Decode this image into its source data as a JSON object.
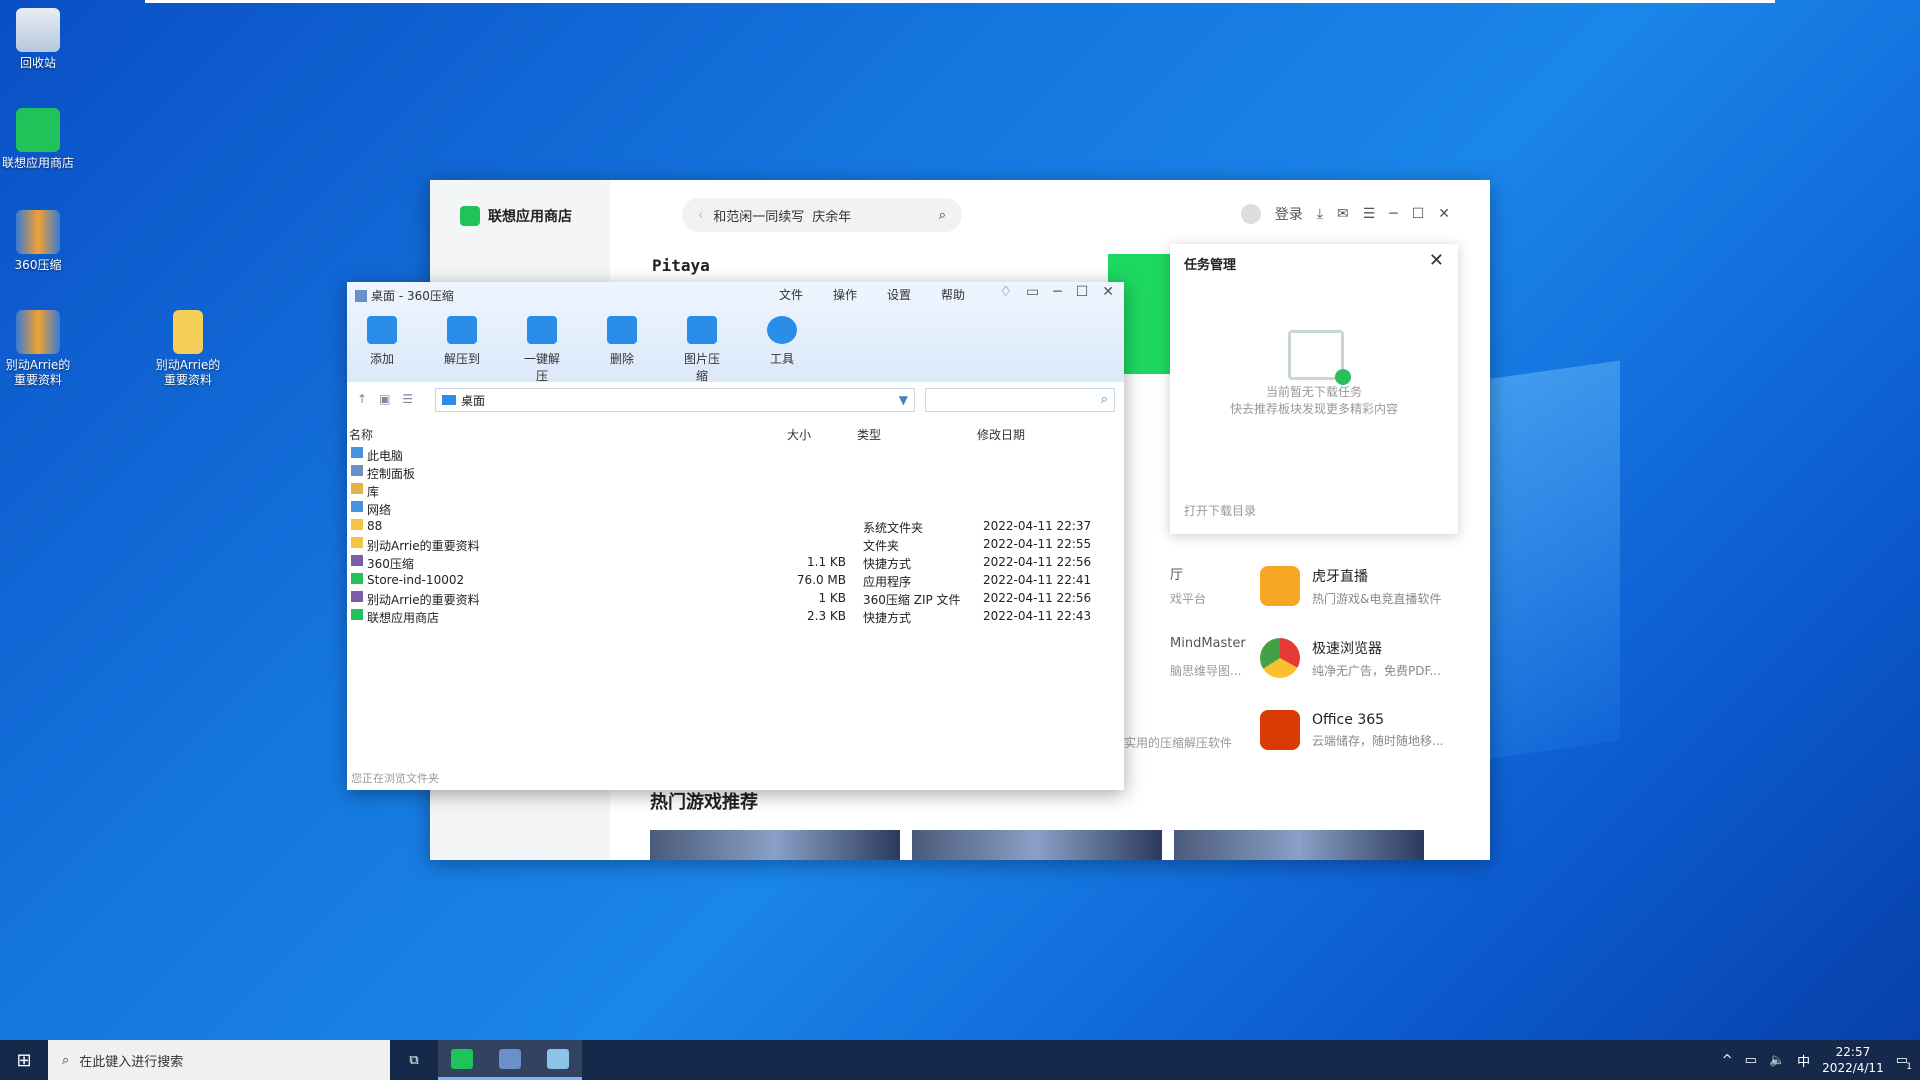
{
  "desktop": {
    "icons": [
      {
        "label": "回收站"
      },
      {
        "label": "联想应用商店"
      },
      {
        "label": "360压缩"
      },
      {
        "label": "别动Arrie的重要资料"
      },
      {
        "label": "别动Arrie的重要资料"
      }
    ]
  },
  "store": {
    "app_name": "联想应用商店",
    "search_placeholder": "和范闲一同续写",
    "search_value": "庆余年",
    "login": "登录",
    "banner_text": "Pitaya",
    "apps": [
      {
        "name": "虎牙直播",
        "desc": "热门游戏&电竞直播软件",
        "color": "#f5a623"
      },
      {
        "name": "极速浏览器",
        "desc": "纯净无广告，免费PDF...",
        "color": "#3aa757"
      },
      {
        "name": "Office 365",
        "desc": "云端储存，随时随地移...",
        "color": "#d83b01"
      }
    ],
    "partials": [
      "厅",
      "戏平台",
      "MindMaster",
      "脑思维导图...",
      "实用的压缩解压软件"
    ],
    "hot_games_title": "热门游戏推荐"
  },
  "task_panel": {
    "title": "任务管理",
    "empty_line1": "当前暂无下载任务",
    "empty_line2": "快去推荐板块发现更多精彩内容",
    "open_dir": "打开下载目录"
  },
  "zip": {
    "title": "桌面 - 360压缩",
    "menu": [
      "文件",
      "操作",
      "设置",
      "帮助"
    ],
    "tools": [
      "添加",
      "解压到",
      "一键解压",
      "删除",
      "图片压缩",
      "工具"
    ],
    "address": "桌面",
    "columns": {
      "name": "名称",
      "size": "大小",
      "type": "类型",
      "date": "修改日期"
    },
    "rows": [
      {
        "name": "此电脑",
        "size": "",
        "type": "",
        "date": "",
        "color": "#4a90e2"
      },
      {
        "name": "控制面板",
        "size": "",
        "type": "",
        "date": "",
        "color": "#6a8fc9"
      },
      {
        "name": "库",
        "size": "",
        "type": "",
        "date": "",
        "color": "#e0b24a"
      },
      {
        "name": "网络",
        "size": "",
        "type": "",
        "date": "",
        "color": "#4a90e2"
      },
      {
        "name": "88",
        "size": "",
        "type": "系统文件夹",
        "date": "2022-04-11 22:37",
        "color": "#f4c542"
      },
      {
        "name": "别动Arrie的重要资料",
        "size": "",
        "type": "文件夹",
        "date": "2022-04-11 22:55",
        "color": "#f4c542"
      },
      {
        "name": "360压缩",
        "size": "1.1 KB",
        "type": "快捷方式",
        "date": "2022-04-11 22:56",
        "color": "#7b5ea7"
      },
      {
        "name": "Store-ind-10002",
        "size": "76.0 MB",
        "type": "应用程序",
        "date": "2022-04-11 22:41",
        "color": "#1fc35a"
      },
      {
        "name": "别动Arrie的重要资料",
        "size": "1 KB",
        "type": "360压缩 ZIP 文件",
        "date": "2022-04-11 22:56",
        "color": "#7b5ea7"
      },
      {
        "name": "联想应用商店",
        "size": "2.3 KB",
        "type": "快捷方式",
        "date": "2022-04-11 22:43",
        "color": "#1fc35a"
      }
    ],
    "status": "您正在浏览文件夹"
  },
  "taskbar": {
    "search_placeholder": "在此键入进行搜索",
    "ime": "中",
    "time": "22:57",
    "date": "2022/4/11",
    "notif_count": "1"
  }
}
